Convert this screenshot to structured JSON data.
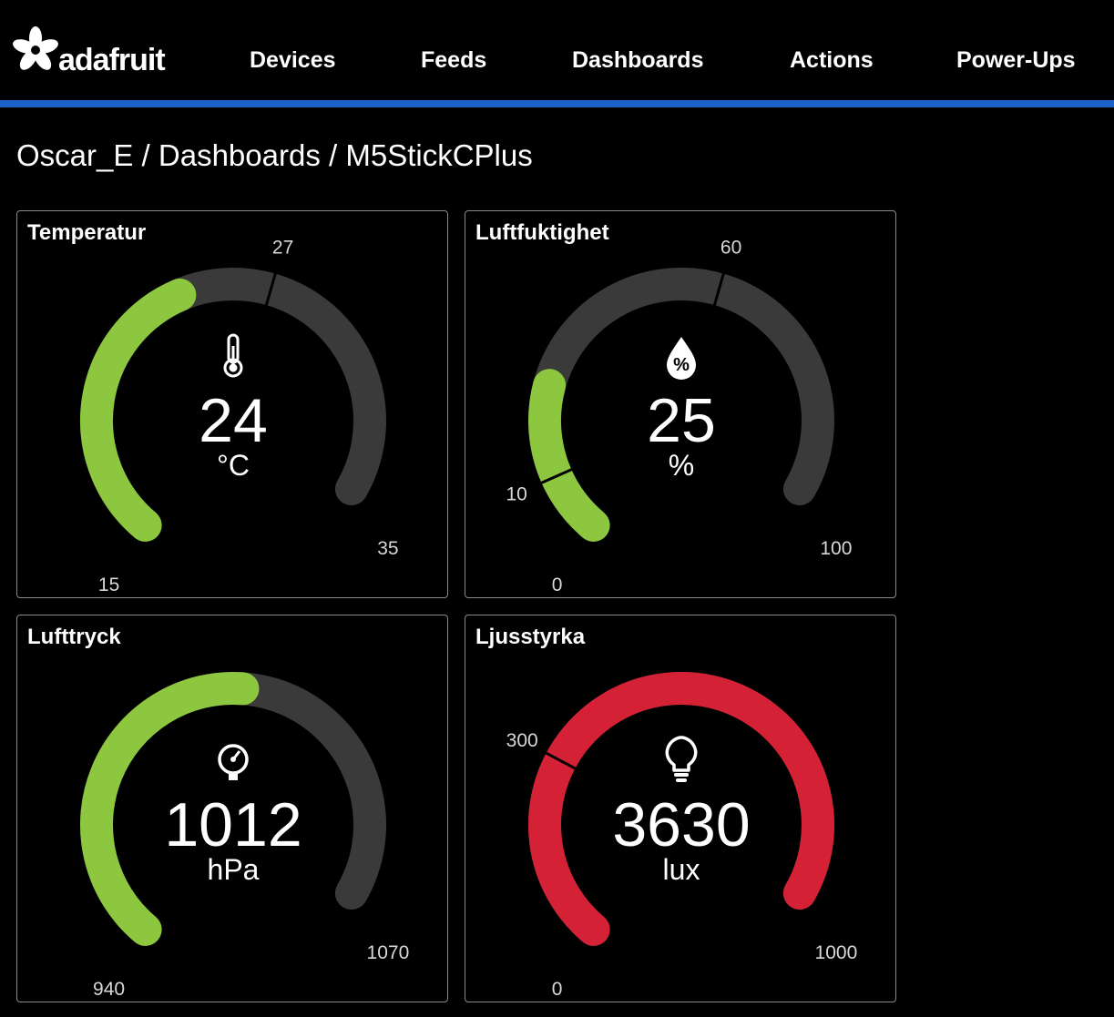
{
  "brand": {
    "name": "adafruit",
    "logo_icon": "adafruit-flower-logo"
  },
  "nav": {
    "items": [
      {
        "label": "Devices"
      },
      {
        "label": "Feeds"
      },
      {
        "label": "Dashboards"
      },
      {
        "label": "Actions"
      },
      {
        "label": "Power-Ups"
      }
    ]
  },
  "breadcrumb": {
    "user": "Oscar_E",
    "section": "Dashboards",
    "page": "M5StickCPlus",
    "separator": "/"
  },
  "colors": {
    "accent_line": "#1a63c9",
    "gauge_track": "#3a3a3a",
    "gauge_green": "#8dc63f",
    "gauge_red": "#d42135"
  },
  "gauges": [
    {
      "title": "Temperatur",
      "icon": "thermometer-icon",
      "value": "24",
      "unit": "°C",
      "min": 15,
      "max": 35,
      "min_label": "15",
      "max_label": "35",
      "threshold": 27,
      "threshold_label": "27",
      "fill_color": "green"
    },
    {
      "title": "Luftfuktighet",
      "icon": "humidity-drop-icon",
      "value": "25",
      "unit": "%",
      "min": 0,
      "max": 100,
      "min_label": "0",
      "max_label": "100",
      "threshold_low": 10,
      "threshold_low_label": "10",
      "threshold": 60,
      "threshold_label": "60",
      "fill_color": "green"
    },
    {
      "title": "Lufttryck",
      "icon": "pressure-gauge-icon",
      "value": "1012",
      "unit": "hPa",
      "min": 940,
      "max": 1070,
      "min_label": "940",
      "max_label": "1070",
      "fill_color": "green"
    },
    {
      "title": "Ljusstyrka",
      "icon": "lightbulb-icon",
      "value": "3630",
      "unit": "lux",
      "min": 0,
      "max": 1000,
      "min_label": "0",
      "max_label": "1000",
      "threshold_low": 300,
      "threshold_low_label": "300",
      "fill_color": "red"
    }
  ]
}
